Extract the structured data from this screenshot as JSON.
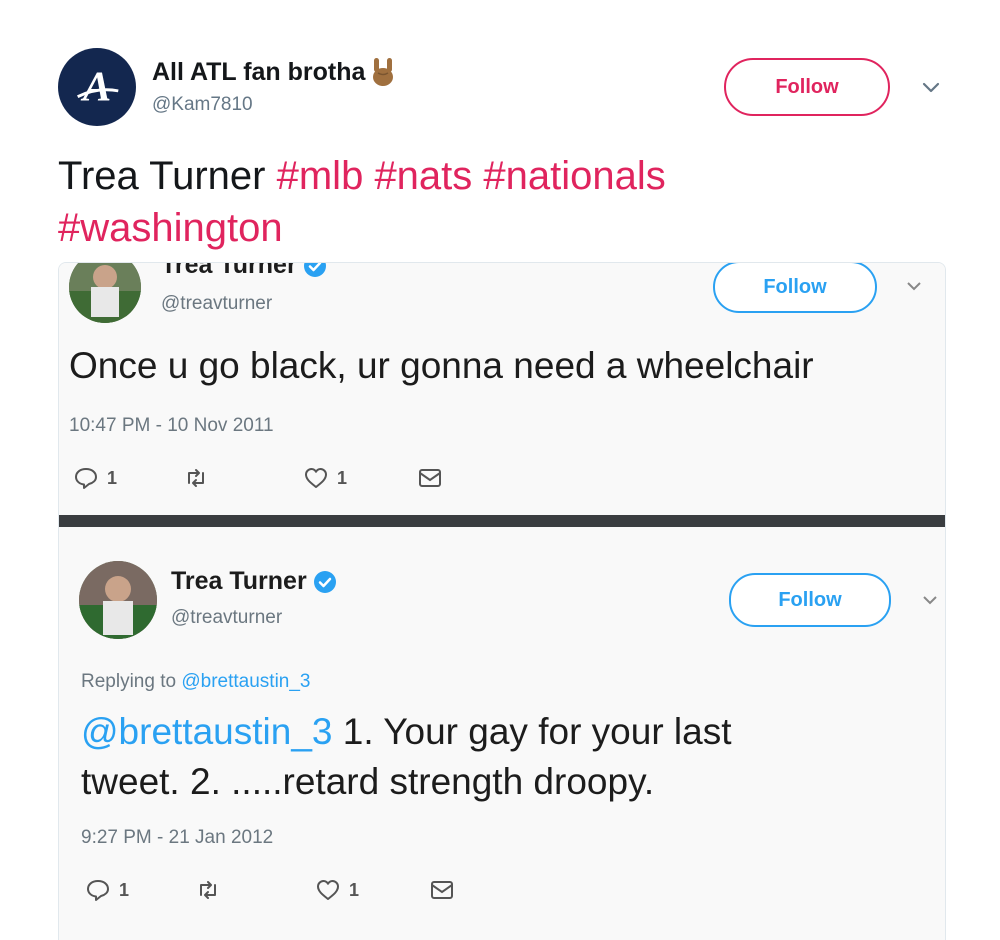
{
  "outer": {
    "display_name": "All ATL fan brotha",
    "handle": "@Kam7810",
    "follow_label": "Follow",
    "text_plain": "Trea Turner",
    "hashtags": [
      "#mlb",
      "#nats",
      "#nationals",
      "#washington"
    ],
    "accent_color": "#e0245e"
  },
  "embedded": {
    "tweet1": {
      "display_name": "Trea Turner",
      "handle": "@treavturner",
      "follow_label": "Follow",
      "text": "Once u go black, ur gonna need a wheelchair",
      "timestamp": "10:47 PM - 10 Nov 2011",
      "reply_count": "1",
      "like_count": "1"
    },
    "tweet2": {
      "display_name": "Trea Turner",
      "handle": "@treavturner",
      "follow_label": "Follow",
      "replying_prefix": "Replying to",
      "replying_to": "@brettaustin_3",
      "mention": "@brettaustin_3",
      "text_line1": " 1. Your gay for your last",
      "text_line2": "tweet. 2. .....retard strength droopy.",
      "timestamp": "9:27 PM - 21 Jan 2012",
      "reply_count": "1",
      "like_count": "1"
    },
    "accent_color": "#2aa1f2"
  }
}
